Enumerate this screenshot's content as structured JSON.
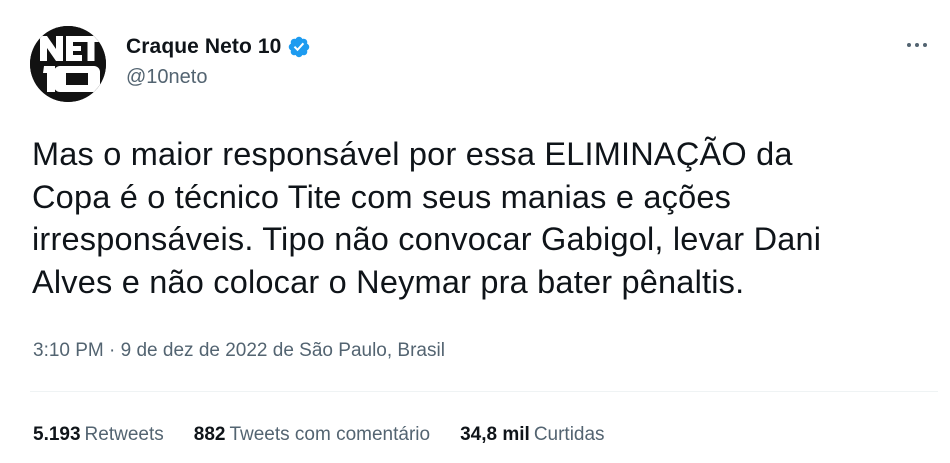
{
  "author": {
    "display_name": "Craque Neto 10",
    "handle": "@10neto",
    "avatar_text": "NETO 10",
    "verified_icon": "verified-badge-icon",
    "verified_color": "#1d9bf0"
  },
  "tweet": {
    "lines": [
      "Mas o maior responsável por essa ELIMINAÇÃO da",
      "Copa é o técnico Tite com seus manias e ações",
      "irresponsáveis. Tipo não convocar Gabigol, levar Dani",
      "Alves e não colocar o Neymar pra bater pênaltis."
    ],
    "timestamp": "3:10 PM · 9 de dez de 2022 de São Paulo, Brasil"
  },
  "more_icon": "more-dots-icon",
  "stats": [
    {
      "count": "5.193",
      "label": "Retweets"
    },
    {
      "count": "882",
      "label": "Tweets com comentário"
    },
    {
      "count": "34,8 mil",
      "label": "Curtidas"
    }
  ],
  "colors": {
    "text_primary": "#0f1419",
    "text_secondary": "#536471",
    "divider": "#eff3f4",
    "avatar_bg": "#121212"
  }
}
